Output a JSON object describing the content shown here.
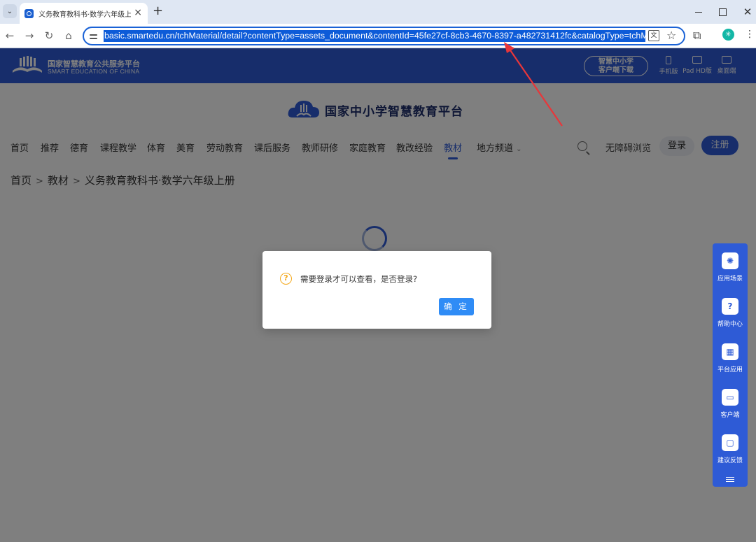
{
  "browser": {
    "tab_title": "义务教育教科书·数学六年级上册",
    "url": "basic.smartedu.cn/tchMaterial/detail?contentType=assets_document&contentId=45fe27cf-8cb3-4670-8397-a482731412fc&catalogType=tchMater"
  },
  "header": {
    "logo_cn": "国家智慧教育公共服务平台",
    "logo_en": "SMART EDUCATION OF CHINA",
    "client_download_line1": "智慧中小学",
    "client_download_line2": "客户端下载",
    "devices": [
      "手机版",
      "Pad HD版",
      "桌面端"
    ]
  },
  "brand": {
    "name": "国家中小学智慧教育平台"
  },
  "nav": {
    "items": [
      "首页",
      "推荐",
      "德育",
      "课程教学",
      "体育",
      "美育",
      "劳动教育",
      "课后服务",
      "教师研修",
      "家庭教育",
      "教改经验",
      "教材",
      "地方频道"
    ],
    "active": "教材",
    "accessible": "无障碍浏览",
    "login": "登录",
    "register": "注册"
  },
  "breadcrumb": [
    "首页",
    "教材",
    "义务教育教科书·数学六年级上册"
  ],
  "side_panel": {
    "items": [
      "应用场景",
      "帮助中心",
      "平台应用",
      "客户端",
      "建议反馈"
    ]
  },
  "dialog": {
    "message": "需要登录才可以查看，是否登录?",
    "confirm": "确 定"
  },
  "colors": {
    "brand_blue": "#2e5bd6",
    "url_highlight": "#0d5bd8",
    "warning": "#f4a91c",
    "annotation_arrow": "#e8363a"
  }
}
